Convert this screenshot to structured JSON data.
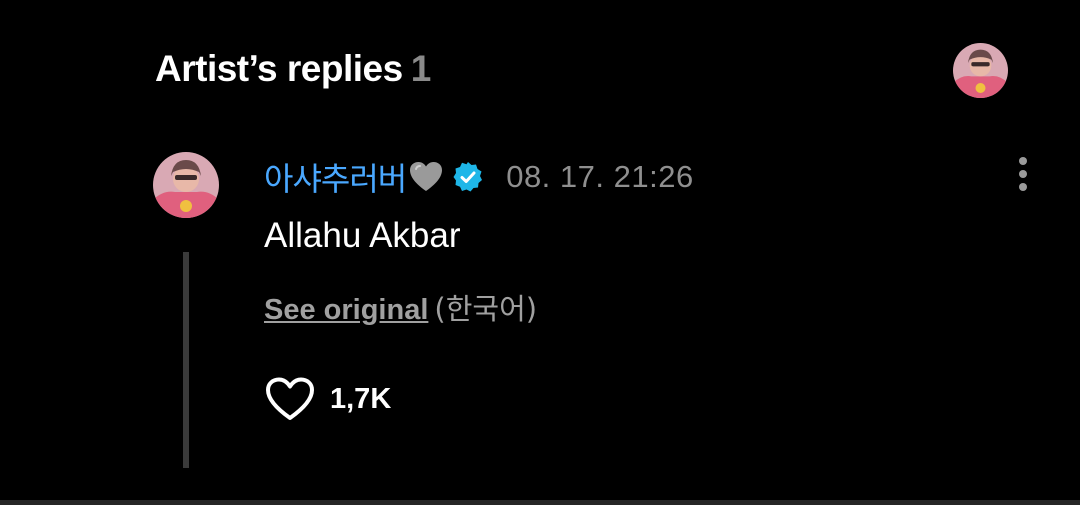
{
  "header": {
    "title": "Artist’s replies",
    "count": "1"
  },
  "comment": {
    "author": "아샤추러버",
    "author_emoji": "grey-heart",
    "verified": true,
    "timestamp": "08. 17. 21:26",
    "text": "Allahu Akbar",
    "see_original_label": "See original",
    "original_language": "(한국어)",
    "like_count": "1,7K"
  },
  "icons": {
    "more": "more-vertical-icon",
    "like": "heart-outline-icon",
    "verified": "verified-badge-icon"
  },
  "colors": {
    "background": "#000000",
    "author": "#4aa8ff",
    "verified_badge": "#1eb6e8",
    "timestamp": "#8f8f8f",
    "thread_line": "#3a3a3a",
    "avatar_pink": "#e0607e"
  }
}
